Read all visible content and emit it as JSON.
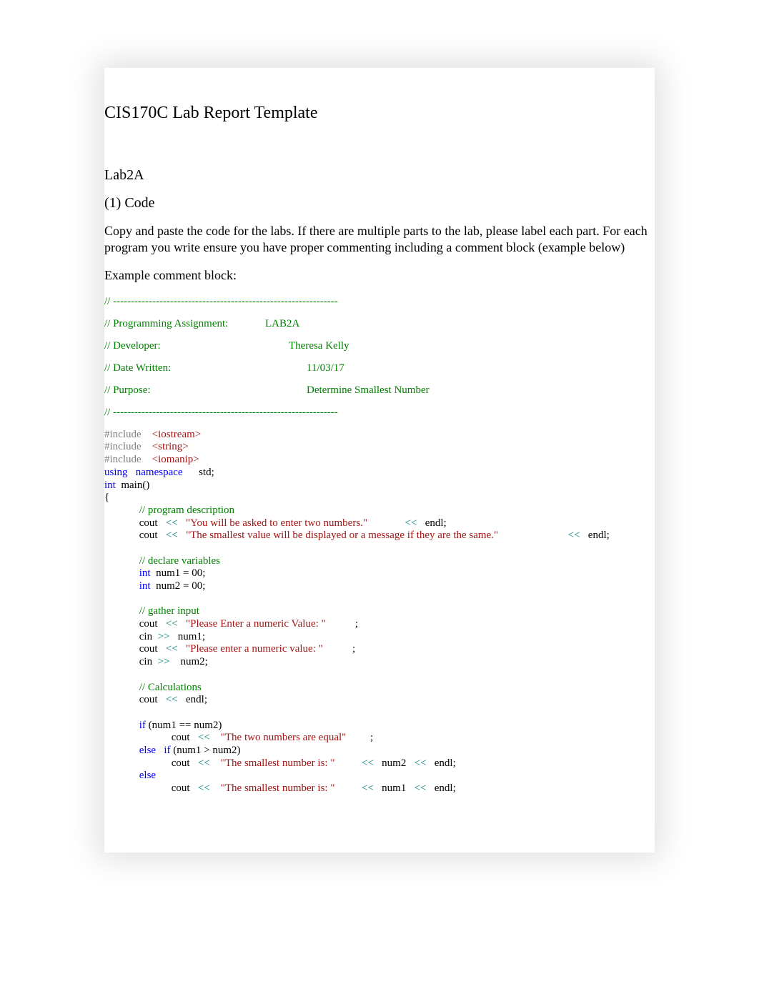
{
  "title": "CIS170C Lab Report Template",
  "section_label": "Lab2A",
  "code_heading": "(1) Code",
  "instructions": "Copy and paste the code for the labs. If there are multiple parts to the lab, please label each part. For each program you write ensure you have proper commenting including a comment block (example below)",
  "example_label": "Example comment block:",
  "header": {
    "dashes1": "// ---------------------------------------------------------------",
    "assign_label": "// Programming Assignment:",
    "assign_val": "LAB2A",
    "dev_label": "// Developer:",
    "dev_val": "Theresa Kelly",
    "date_label": "// Date Written:",
    "date_val": "11/03/17",
    "purpose_label": "// Purpose:",
    "purpose_val": "Determine Smallest Number",
    "dashes2": "// ---------------------------------------------------------------"
  },
  "code": {
    "include": "#include",
    "iostream": "<iostream>",
    "string": "<string>",
    "iomanip": "<iomanip>",
    "using": "using",
    "namespace": "namespace",
    "std": "std;",
    "int": "int",
    "main": "main()",
    "lbrace": "{",
    "c_desc": "// program description",
    "cout": "cout",
    "ltlt": "<<",
    "gtgt": ">>",
    "s1": "\"You will be asked to enter two numbers.\"",
    "endl": "endl;",
    "s2": "\"The smallest value will be displayed or a message if they are the same.\"",
    "c_vars": "// declare variables",
    "num1d": "num1 = 00;",
    "num2d": "num2 = 00;",
    "c_input": "// gather input",
    "s3": "\"Please Enter a numeric Value: \"",
    "semi": ";",
    "cin": "cin",
    "num1": "num1;",
    "s4": "\"Please enter a numeric value: \"",
    "num2": "num2;",
    "c_calc": "// Calculations",
    "if": "if",
    "cond1": "(num1 == num2)",
    "s5": "\"The two numbers are equal\"",
    "else": "else",
    "cond2": "(num1 > num2)",
    "s6": "\"The smallest number is: \"",
    "num2o": "num2",
    "num1o": "num1"
  }
}
